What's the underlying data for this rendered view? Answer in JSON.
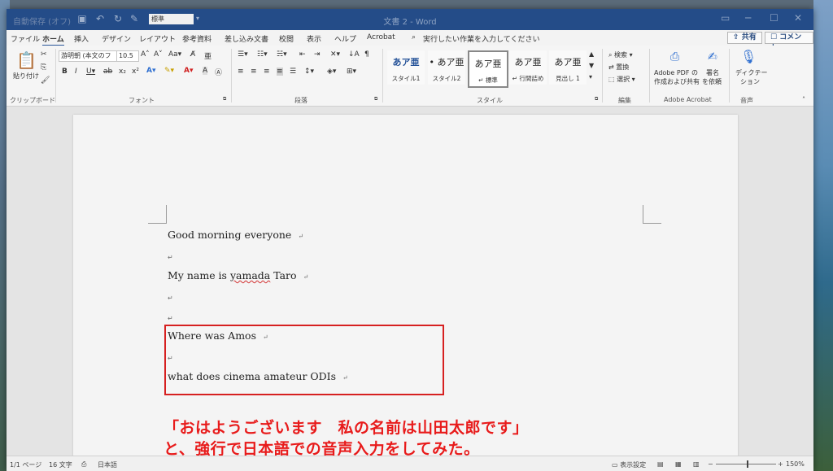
{
  "titlebar": {
    "autosave_label": "自動保存 (オフ)",
    "style_value": "標準",
    "document_title": "文書 2  -  Word"
  },
  "tabs": [
    "ファイル",
    "ホーム",
    "挿入",
    "デザイン",
    "レイアウト",
    "参考資料",
    "差し込み文書",
    "校閲",
    "表示",
    "ヘルプ",
    "Acrobat"
  ],
  "tell_me": "実行したい作業を入力してください",
  "share_label": "共有",
  "comment_label": "コメント",
  "ribbon": {
    "clipboard": {
      "paste": "貼り付け",
      "label": "クリップボード"
    },
    "font": {
      "name": "游明朝 (本文のフ",
      "size": "10.5",
      "label": "フォント"
    },
    "paragraph": {
      "label": "段落"
    },
    "styles": {
      "items": [
        {
          "preview": "あア亜",
          "name": "スタイル1"
        },
        {
          "preview": "• あア亜",
          "name": "スタイル2"
        },
        {
          "preview": "あア亜",
          "name": "↵ 標準"
        },
        {
          "preview": "あア亜",
          "name": "↵ 行間詰め"
        },
        {
          "preview": "あア亜",
          "name": "見出し 1"
        }
      ],
      "label": "スタイル"
    },
    "editing": {
      "find": "検索",
      "replace": "置換",
      "select": "選択",
      "label": "編集"
    },
    "acrobat": {
      "create_pdf_1": "Adobe PDF の",
      "create_pdf_2": "作成および共有",
      "sign_1": "署名",
      "sign_2": "を依頼",
      "label": "Adobe Acrobat"
    },
    "voice": {
      "dictate_1": "ディクテー",
      "dictate_2": "ション",
      "label": "音声"
    }
  },
  "document": {
    "lines": [
      "Good morning everyone",
      "My name is",
      "yamada",
      "Taro",
      "Where was Amos",
      "what does cinema amateur ODIs"
    ],
    "para_mark": "↵"
  },
  "caption": {
    "line1": "「おはようございます　私の名前は山田太郎です」",
    "line2": "と、強行で日本語での音声入力をしてみた。"
  },
  "statusbar": {
    "page": "1/1 ページ",
    "words": "16 文字",
    "language": "日本語",
    "display_settings": "表示設定",
    "zoom": "150%"
  }
}
